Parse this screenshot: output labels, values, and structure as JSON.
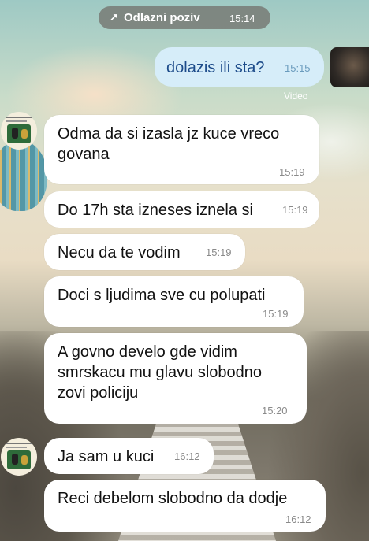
{
  "call": {
    "label": "Odlazni poziv",
    "time": "15:14"
  },
  "outgoing": {
    "text": "dolazis ili sta?",
    "time": "15:15",
    "media_label": "Video"
  },
  "messages": [
    {
      "text": "Odma da si izasla jz kuce vreco\ngovana",
      "time": "15:19"
    },
    {
      "text": "Do 17h sta izneses iznela si",
      "time": "15:19"
    },
    {
      "text": "Necu da te vodim",
      "time": "15:19"
    },
    {
      "text": "Doci s ljudima sve cu polupati",
      "time": "15:19"
    },
    {
      "text": "A govno develo gde vidim\nsmrskacu mu glavu slobodno\nzovi policiju",
      "time": "15:20"
    },
    {
      "text": "Ja sam u kuci",
      "time": "16:12"
    },
    {
      "text": "Reci debelom slobodno da dodje",
      "time": "16:12"
    }
  ],
  "icons": {
    "call_arrow": "outgoing-call-arrow-icon",
    "contact_avatar": "contact-avatar",
    "self_avatar": "self-avatar"
  },
  "colors": {
    "outgoing_bubble": "#d6edf9",
    "outgoing_text": "#1c4b8a",
    "incoming_bubble": "#ffffff",
    "pill_bg": "#73736e"
  }
}
